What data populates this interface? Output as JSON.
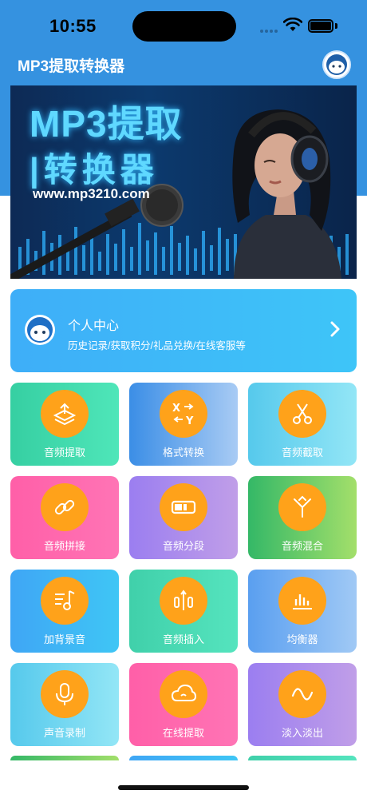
{
  "status": {
    "time": "10:55"
  },
  "header": {
    "title": "MP3提取转换器",
    "avatar_icon": "user-avatar-icon"
  },
  "banner": {
    "line1": "MP3提取",
    "line2": "|转换器",
    "url": "www.mp3210.com"
  },
  "profile": {
    "title": "个人中心",
    "subtitle": "历史记录/获取积分/礼品兑换/在线客服等"
  },
  "tools": [
    {
      "label": "音频提取",
      "icon": "extract-icon"
    },
    {
      "label": "格式转换",
      "icon": "convert-icon"
    },
    {
      "label": "音频截取",
      "icon": "scissors-icon"
    },
    {
      "label": "音频拼接",
      "icon": "link-icon"
    },
    {
      "label": "音频分段",
      "icon": "segment-icon"
    },
    {
      "label": "音频混合",
      "icon": "merge-icon"
    },
    {
      "label": "加背景音",
      "icon": "music-note-icon"
    },
    {
      "label": "音频插入",
      "icon": "insert-icon"
    },
    {
      "label": "均衡器",
      "icon": "equalizer-icon"
    },
    {
      "label": "声音录制",
      "icon": "microphone-icon"
    },
    {
      "label": "在线提取",
      "icon": "cloud-icon"
    },
    {
      "label": "淡入淡出",
      "icon": "wave-icon"
    }
  ],
  "colors": {
    "accent": "#ffa21a",
    "header_bg": "#3592e0"
  }
}
